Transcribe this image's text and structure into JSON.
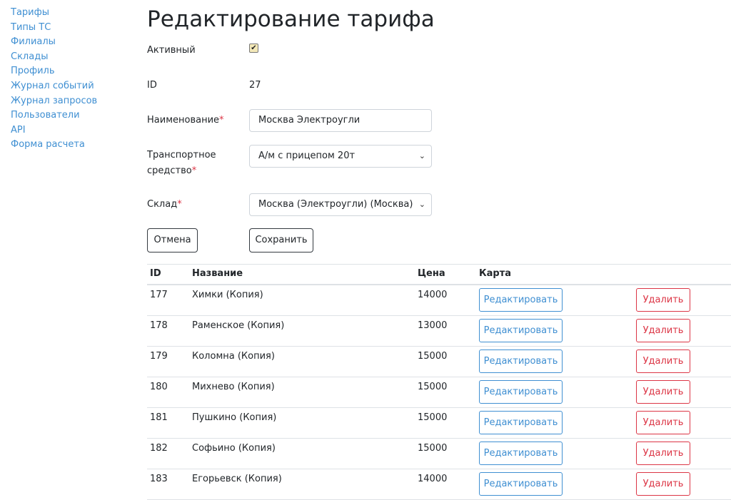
{
  "sidebar": {
    "items": [
      {
        "label": "Тарифы"
      },
      {
        "label": "Типы ТС"
      },
      {
        "label": "Филиалы"
      },
      {
        "label": "Склады"
      },
      {
        "label": "Профиль"
      },
      {
        "label": "Журнал событий"
      },
      {
        "label": "Журнал запросов"
      },
      {
        "label": "Пользователи"
      },
      {
        "label": "API"
      },
      {
        "label": "Форма расчета"
      }
    ]
  },
  "page": {
    "title": "Редактирование тарифа"
  },
  "form": {
    "active_label": "Активный",
    "active_checked": true,
    "id_label": "ID",
    "id_value": "27",
    "name_label": "Наименование",
    "name_value": "Москва Электроугли",
    "vehicle_label_line1": "Транспортное",
    "vehicle_label_line2": "средство",
    "vehicle_value": "А/м с прицепом 20т",
    "warehouse_label": "Склад",
    "warehouse_value": "Москва (Электроугли) (Москва)",
    "required_mark": "*",
    "cancel_label": "Отмена",
    "save_label": "Сохранить"
  },
  "table": {
    "headers": {
      "id": "ID",
      "name": "Название",
      "price": "Цена",
      "map": "Карта"
    },
    "edit_label": "Редактировать",
    "delete_label": "Удалить",
    "rows": [
      {
        "id": "177",
        "name": "Химки (Копия)",
        "price": "14000"
      },
      {
        "id": "178",
        "name": "Раменское (Копия)",
        "price": "13000"
      },
      {
        "id": "179",
        "name": "Коломна (Копия)",
        "price": "15000"
      },
      {
        "id": "180",
        "name": "Михнево (Копия)",
        "price": "15000"
      },
      {
        "id": "181",
        "name": "Пушкино (Копия)",
        "price": "15000"
      },
      {
        "id": "182",
        "name": "Софьино (Копия)",
        "price": "15000"
      },
      {
        "id": "183",
        "name": "Егорьевск (Копия)",
        "price": "14000"
      }
    ]
  },
  "colors": {
    "link": "#3f8fd2",
    "danger": "#dc3545",
    "text": "#212529"
  },
  "icons": {
    "select_chevron": "chevron-down-icon",
    "checkbox": "check-icon"
  }
}
